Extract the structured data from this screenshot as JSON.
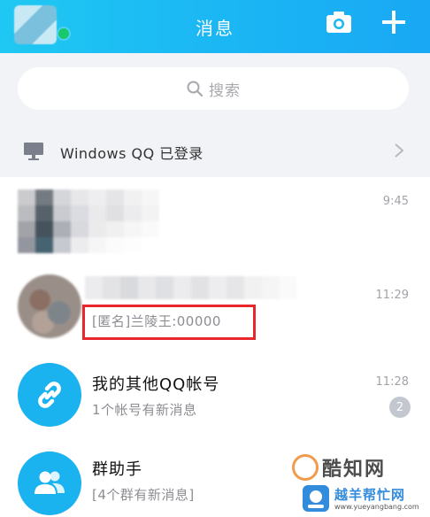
{
  "header": {
    "title": "消息"
  },
  "search": {
    "placeholder": "搜索"
  },
  "login_banner": {
    "text": "Windows QQ 已登录"
  },
  "chats": [
    {
      "time": "9:45"
    },
    {
      "preview": "[匿名]兰陵王:00000",
      "time": "11:29"
    },
    {
      "name": "我的其他QQ帐号",
      "preview": "1个帐号有新消息",
      "time": "11:28",
      "badge": "2"
    },
    {
      "name": "群助手",
      "preview": "[4个群有新消息]"
    }
  ],
  "watermarks": {
    "primary": "酷知网",
    "secondary": "越羊帮忙网",
    "url": "www.yueyangbang.com"
  },
  "colors": {
    "header_start": "#1fc8f2",
    "header_end": "#19a8f4",
    "accent_blue": "#1ab2ef",
    "highlight_red": "#e8262c",
    "online_green": "#19c86a"
  }
}
